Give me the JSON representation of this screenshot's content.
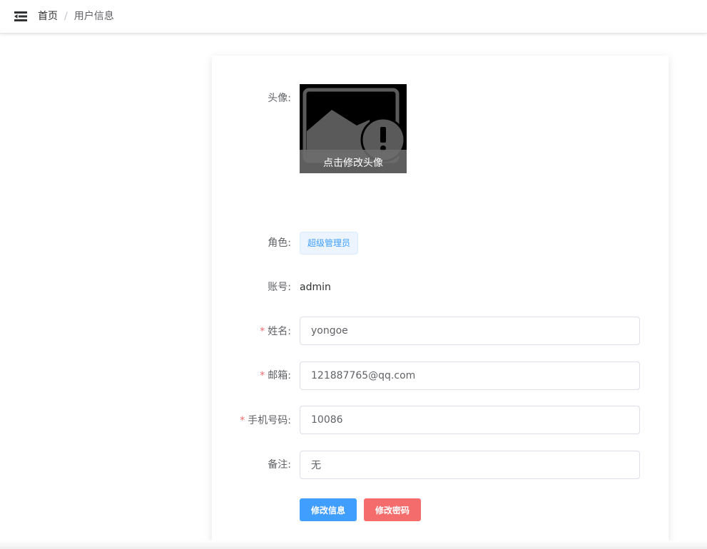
{
  "breadcrumb": {
    "home": "首页",
    "separator": "/",
    "current": "用户信息"
  },
  "form": {
    "avatar_label": "头像:",
    "avatar_overlay": "点击修改头像",
    "role_label": "角色:",
    "role_value": "超级管理员",
    "account_label": "账号:",
    "account_value": "admin",
    "name_label": "姓名:",
    "name_value": "yongoe",
    "email_label": "邮箱:",
    "email_value": "121887765@qq.com",
    "phone_label": "手机号码:",
    "phone_value": "10086",
    "remark_label": "备注:",
    "remark_value": "无",
    "required_mark": "*"
  },
  "buttons": {
    "edit_info": "修改信息",
    "edit_password": "修改密码"
  },
  "icons": {
    "menu": "hamburger-icon",
    "avatar_placeholder": "image-error-icon"
  },
  "colors": {
    "primary": "#409eff",
    "danger": "#f56c6c",
    "tag_bg": "#ecf5ff",
    "required": "#f56c6c"
  }
}
